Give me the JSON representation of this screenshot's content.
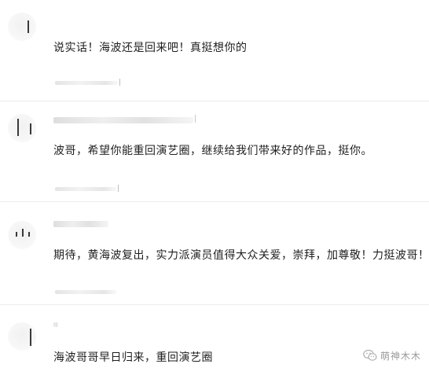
{
  "comments": [
    {
      "text": "说实话！海波还是回来吧！真挺想你的"
    },
    {
      "text": "波哥，希望你能重回演艺圈，继续给我们带来好的作品，挺你。"
    },
    {
      "text": "期待，黄海波复出，实力派演员值得大众关爱，崇拜，加尊敬！力挺波哥！"
    },
    {
      "text": "海波哥哥早日归来，重回演艺圈"
    }
  ],
  "watermark": {
    "text": "萌神木木",
    "icon": "wechat-icon"
  }
}
